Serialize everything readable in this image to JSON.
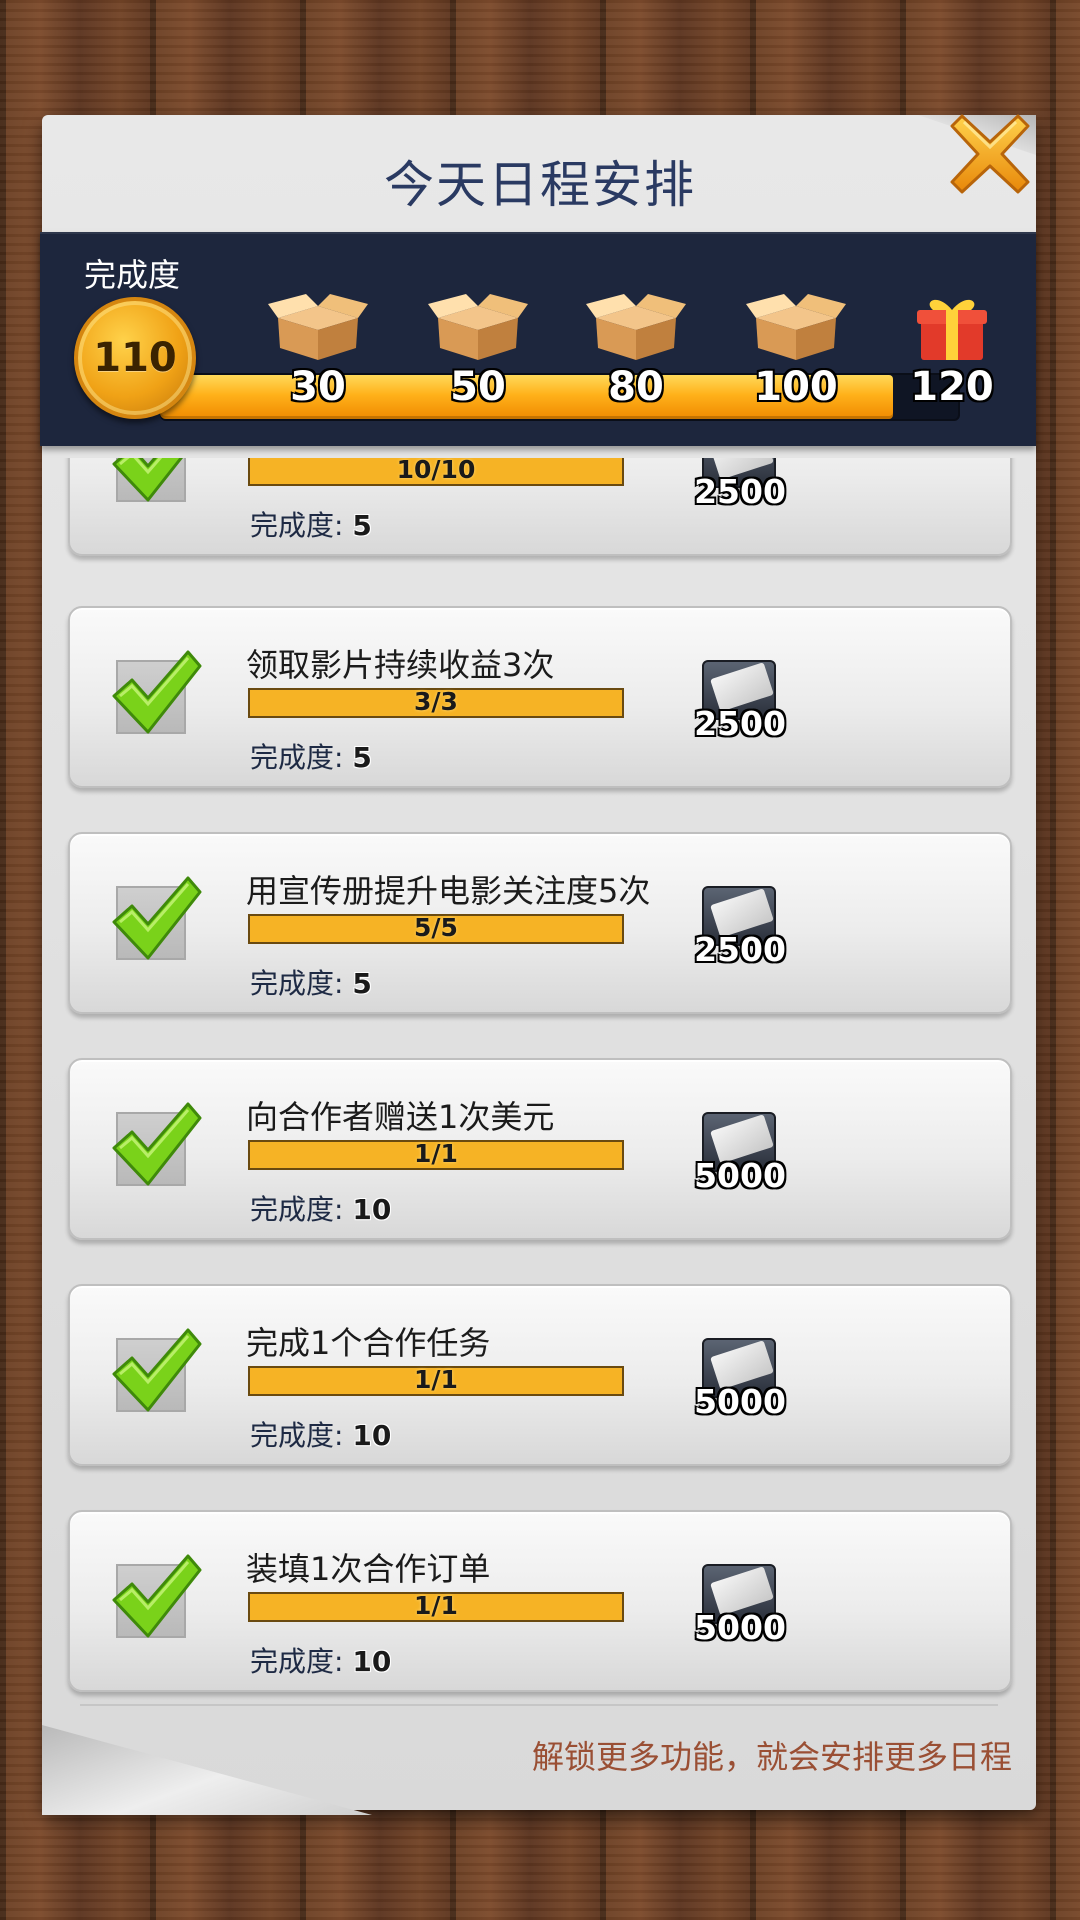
{
  "header": {
    "title": "今天日程安排",
    "close_icon": "close-x-icon"
  },
  "progress": {
    "label": "完成度",
    "current": "110",
    "max": 120,
    "milestones": [
      {
        "value": "30",
        "icon": "open-box-icon"
      },
      {
        "value": "50",
        "icon": "open-box-icon"
      },
      {
        "value": "80",
        "icon": "open-box-icon"
      },
      {
        "value": "100",
        "icon": "open-box-icon"
      },
      {
        "value": "120",
        "icon": "gift-box-icon"
      }
    ],
    "fill_color": "#ffb11a"
  },
  "tasks": [
    {
      "title": "",
      "progress": "10/10",
      "points_label": "完成度:",
      "points": "5",
      "reward": "2500",
      "completed": true
    },
    {
      "title": "领取影片持续收益3次",
      "progress": "3/3",
      "points_label": "完成度:",
      "points": "5",
      "reward": "2500",
      "completed": true
    },
    {
      "title": "用宣传册提升电影关注度5次",
      "progress": "5/5",
      "points_label": "完成度:",
      "points": "5",
      "reward": "2500",
      "completed": true
    },
    {
      "title": "向合作者赠送1次美元",
      "progress": "1/1",
      "points_label": "完成度:",
      "points": "10",
      "reward": "5000",
      "completed": true
    },
    {
      "title": "完成1个合作任务",
      "progress": "1/1",
      "points_label": "完成度:",
      "points": "10",
      "reward": "5000",
      "completed": true
    },
    {
      "title": "装填1次合作订单",
      "progress": "1/1",
      "points_label": "完成度:",
      "points": "10",
      "reward": "5000",
      "completed": true
    }
  ],
  "footer": {
    "note": "解锁更多功能，就会安排更多日程"
  },
  "colors": {
    "title_text": "#2a3a62",
    "band_bg": "#1d263d",
    "task_bar": "#f6b325",
    "check_green": "#7ad21a",
    "footer_text": "#9a4f34"
  }
}
